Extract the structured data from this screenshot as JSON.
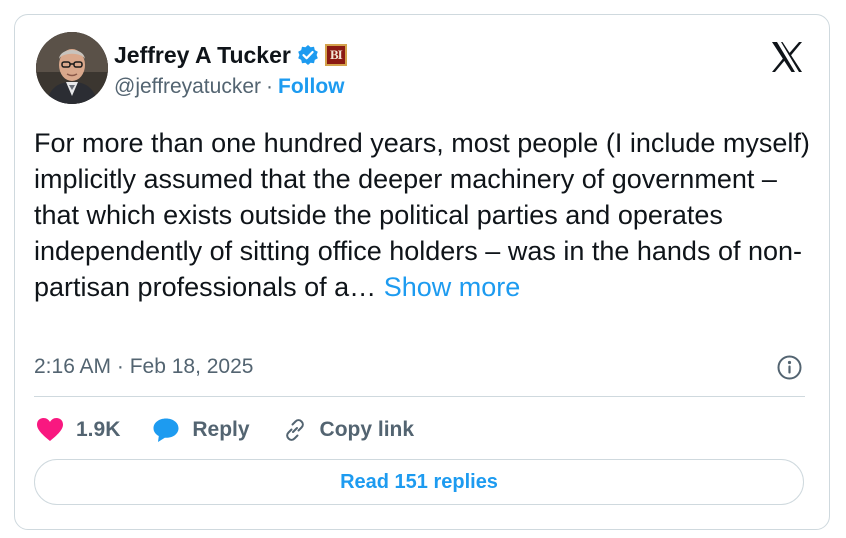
{
  "colors": {
    "accent": "#1d9bf0",
    "secondary_text": "#536471",
    "like": "#f91880",
    "border": "#cfd9de"
  },
  "author": {
    "name": "Jeffrey A Tucker",
    "handle": "@jeffreyatucker",
    "separator": "·",
    "follow_label": "Follow",
    "affiliation_badge": "BI",
    "avatar_icon": "profile-photo",
    "verified_icon": "verified-badge-icon"
  },
  "platform_icon": "x-logo-icon",
  "tweet": {
    "text": "For more than one hundred years, most people (I include myself) implicitly assumed that the deeper machinery of government – that which exists outside the political parties and operates independently of sitting office holders – was in the hands of  non-partisan professionals of a…",
    "show_more_label": "Show more",
    "timestamp": "2:16 AM · Feb 18, 2025"
  },
  "actions": {
    "like_count": "1.9K",
    "reply_label": "Reply",
    "copy_link_label": "Copy link"
  },
  "read_replies_label": "Read 151 replies"
}
